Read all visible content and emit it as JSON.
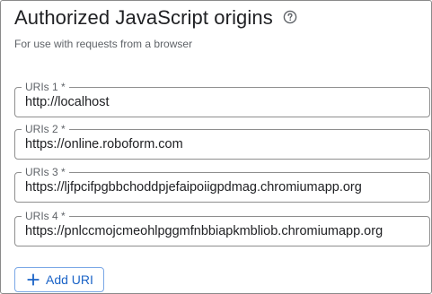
{
  "section": {
    "title": "Authorized JavaScript origins",
    "help_icon": "help-circle-icon",
    "subtitle": "For use with requests from a browser"
  },
  "uris": [
    {
      "label": "URIs 1 *",
      "value": "http://localhost"
    },
    {
      "label": "URIs 2 *",
      "value": "https://online.roboform.com"
    },
    {
      "label": "URIs 3 *",
      "value": "https://ljfpcifpgbbchoddpjefaipoiigpdmag.chromiumapp.org"
    },
    {
      "label": "URIs 4 *",
      "value": "https://pnlccmojcmeohlpggmfnbbiapkmbliob.chromiumapp.org"
    }
  ],
  "add_button": {
    "icon": "plus-icon",
    "label": "Add URI"
  },
  "colors": {
    "accent": "#1a63c7",
    "button_border": "#7aa7e6",
    "field_border": "#8e8e8e",
    "text": "#202124",
    "muted_text": "#5f6368"
  }
}
